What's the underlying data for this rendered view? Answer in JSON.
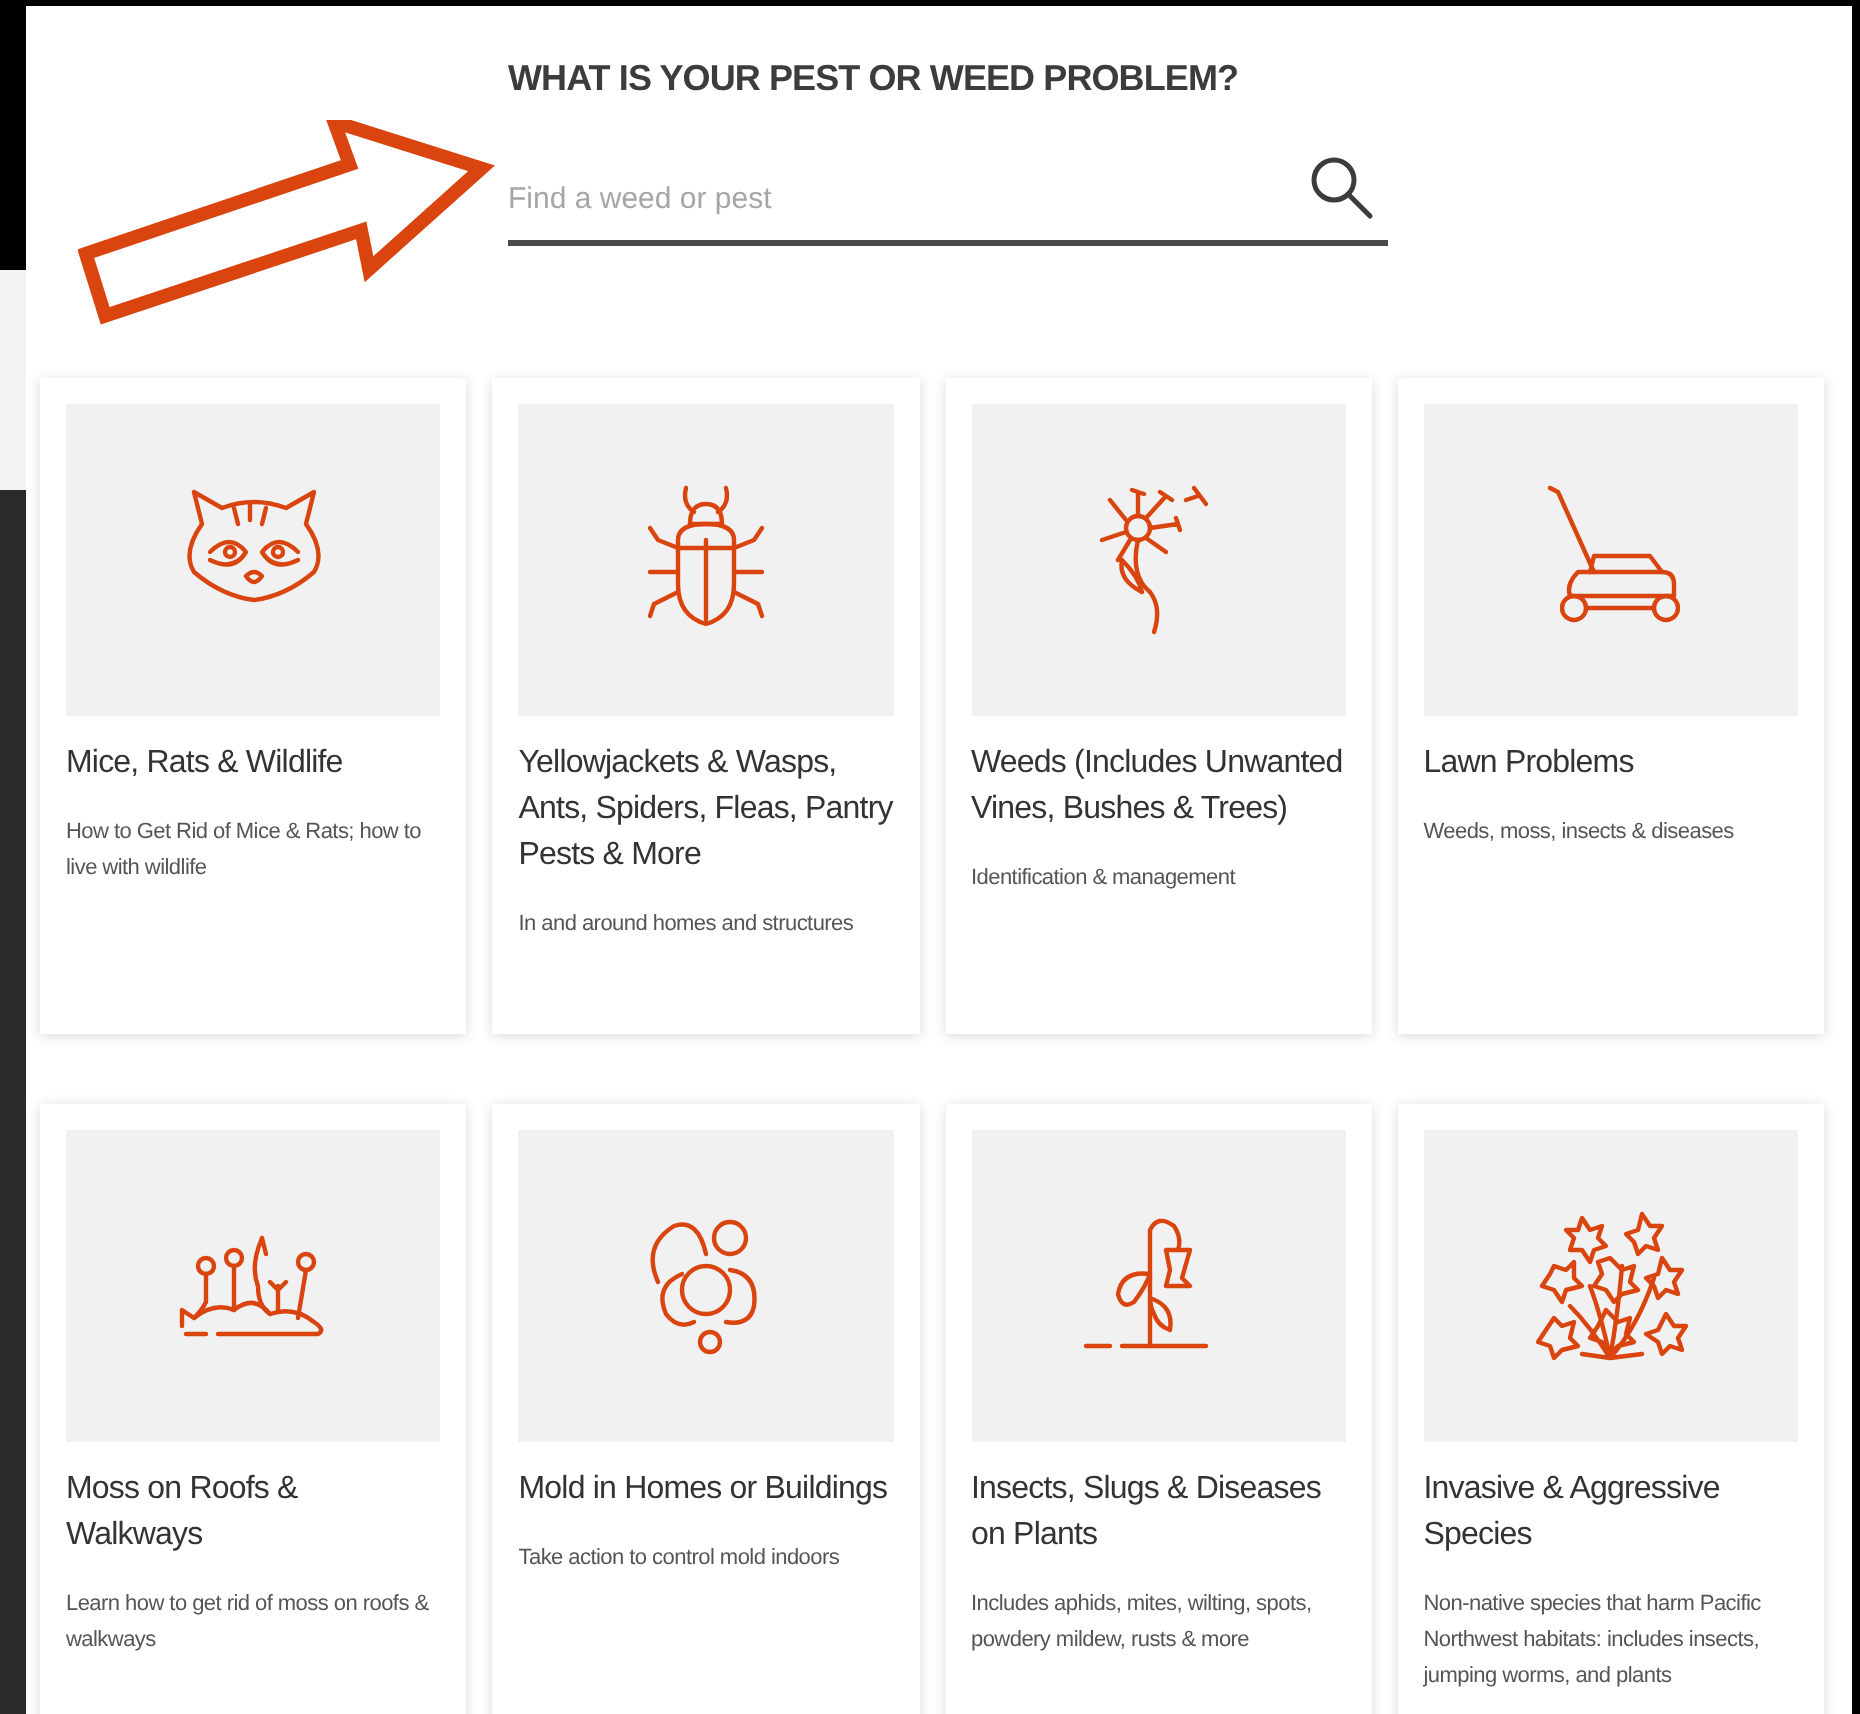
{
  "heading": "WHAT IS YOUR PEST OR WEED PROBLEM?",
  "search": {
    "placeholder": "Find a weed or pest"
  },
  "categories": [
    {
      "title": "Mice, Rats & Wildlife",
      "description": "How to Get Rid of Mice & Rats; how to live with wildlife"
    },
    {
      "title": "Yellowjackets & Wasps, Ants, Spiders, Fleas, Pantry Pests & More",
      "description": "In and around homes and structures"
    },
    {
      "title": "Weeds (Includes Unwanted Vines, Bushes & Trees)",
      "description": "Identification & management"
    },
    {
      "title": "Lawn Problems",
      "description": "Weeds, moss, insects & diseases"
    },
    {
      "title": "Moss on Roofs & Walkways",
      "description": "Learn how to get rid of moss on roofs & walkways"
    },
    {
      "title": "Mold in Homes or Buildings",
      "description": "Take action to control mold indoors"
    },
    {
      "title": "Insects, Slugs & Diseases on Plants",
      "description": "Includes aphids, mites, wilting, spots, powdery mildew, rusts & more"
    },
    {
      "title": "Invasive & Aggressive Species",
      "description": "Non-native species that harm Pacific Northwest habitats: includes insects, jumping worms, and plants"
    }
  ]
}
